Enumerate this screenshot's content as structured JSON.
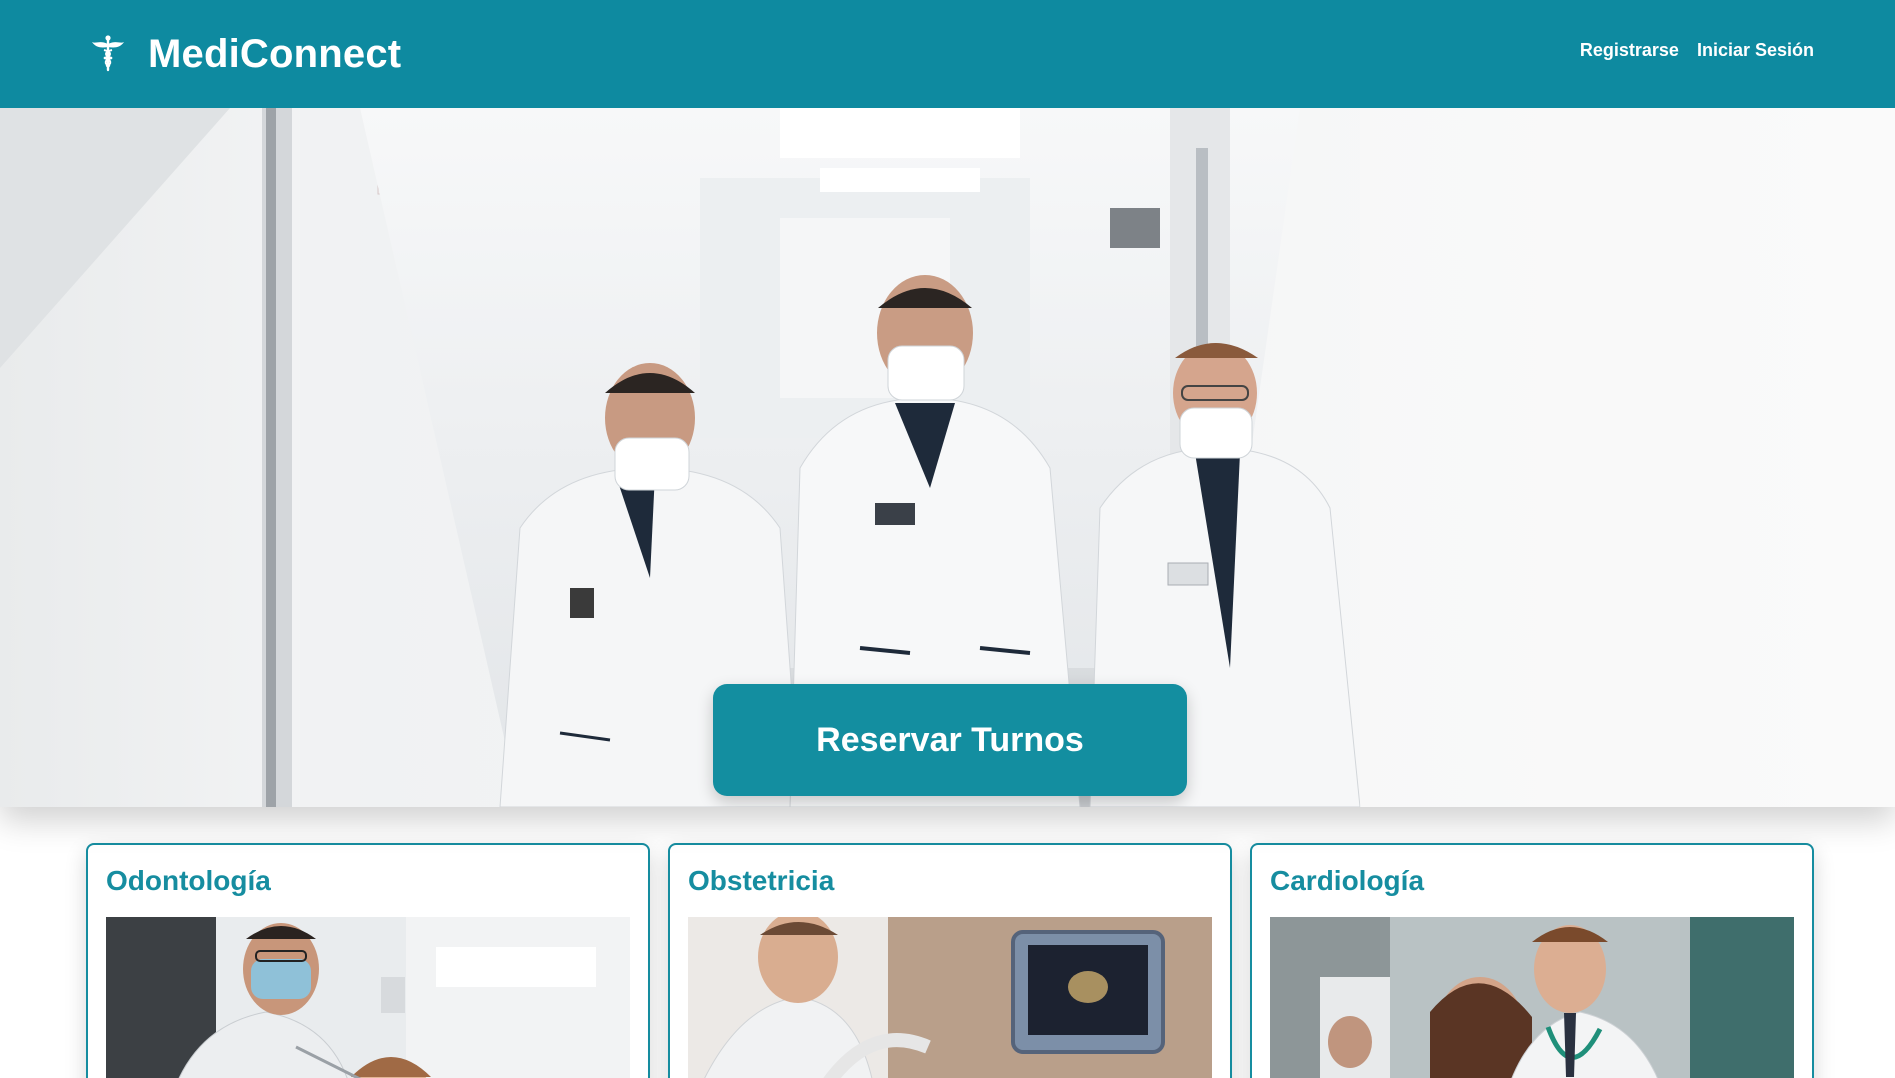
{
  "header": {
    "brand": "MediConnect",
    "logo_icon": "caduceus-icon",
    "nav": {
      "register": "Registrarse",
      "login": "Iniciar Sesión"
    }
  },
  "colors": {
    "primary": "#0e8aa0",
    "accent": "#138ea0",
    "card_border": "#168da0"
  },
  "hero": {
    "image": "doctors-hallway-photo",
    "cta_label": "Reservar Turnos"
  },
  "specialties": [
    {
      "title": "Odontología",
      "image": "dentist-photo"
    },
    {
      "title": "Obstetricia",
      "image": "ultrasound-photo"
    },
    {
      "title": "Cardiología",
      "image": "cardiology-photo"
    }
  ]
}
